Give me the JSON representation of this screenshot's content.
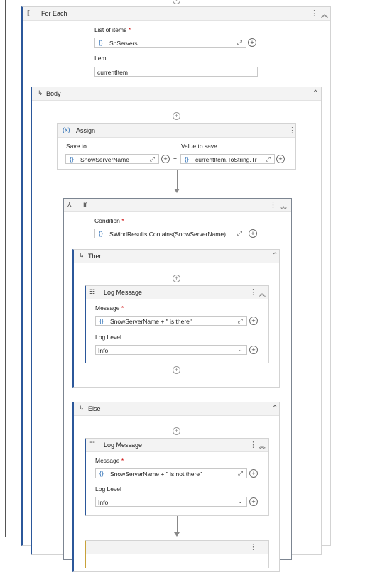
{
  "for_each": {
    "title": "For Each",
    "list_label": "List of items",
    "list_value": "SnServers",
    "item_label": "Item",
    "item_value": "currentItem"
  },
  "body": {
    "title": "Body"
  },
  "assign": {
    "icon": "(x)",
    "title": "Assign",
    "save_to_label": "Save to",
    "save_to_value": "SnowServerName",
    "equals": "=",
    "value_label": "Value to save",
    "value_value": "currentItem.ToString.Tr"
  },
  "if_activity": {
    "title": "If",
    "condition_label": "Condition",
    "condition_value": "SWindResults.Contains(SnowServerName)"
  },
  "then": {
    "title": "Then",
    "log": {
      "title": "Log Message",
      "message_label": "Message",
      "message_value": "SnowServerName + \" is there\"",
      "level_label": "Log Level",
      "level_value": "Info"
    }
  },
  "else": {
    "title": "Else",
    "log": {
      "title": "Log Message",
      "message_label": "Message",
      "message_value": "SnowServerName + \" is not there\"",
      "level_label": "Log Level",
      "level_value": "Info"
    }
  },
  "common": {
    "required_mark": "*",
    "expression_glyph": "{}",
    "expand_glyph": "⤢",
    "plus_glyph": "+",
    "kebab_glyph": "⋮",
    "collapse_glyph": "⌃",
    "collapse_double_glyph": "«",
    "dropdown_glyph": "⌄",
    "branch_glyph": "↳"
  }
}
